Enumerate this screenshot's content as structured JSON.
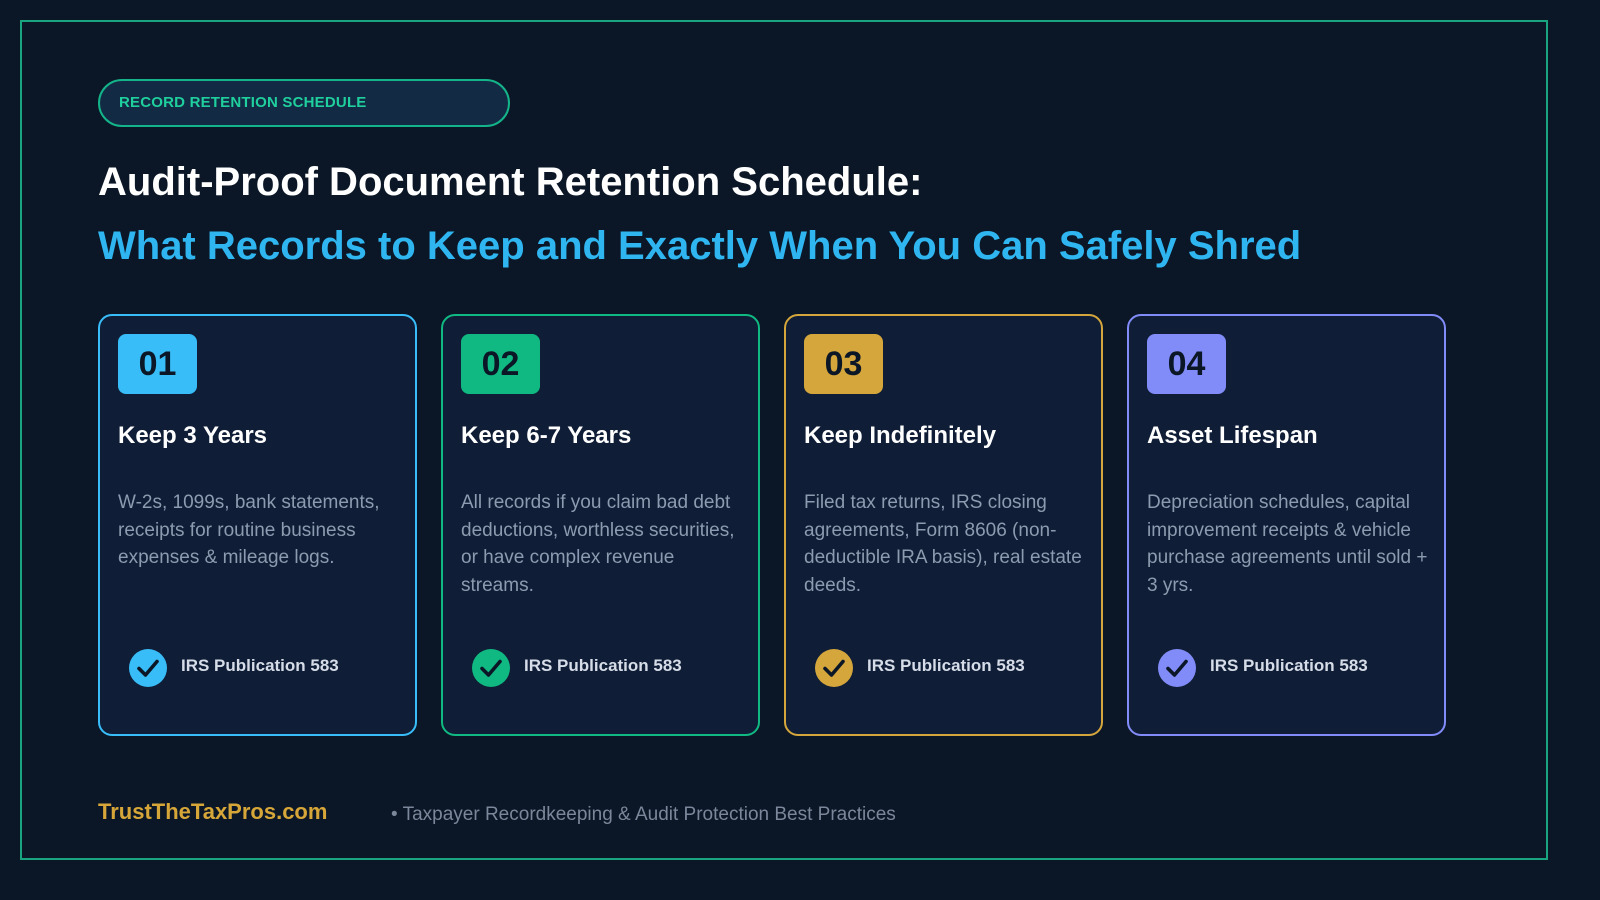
{
  "header": {
    "pill_label": "RECORD RETENTION SCHEDULE",
    "title_line1": "Audit-Proof Document Retention Schedule:",
    "title_line2": "What Records to Keep and Exactly When You Can Safely Shred"
  },
  "cards": [
    {
      "number": "01",
      "title": "Keep 3 Years",
      "description": "W-2s, 1099s, bank statements, receipts for routine business expenses & mileage logs.",
      "source": "IRS Publication 583",
      "color": "#38bdf8"
    },
    {
      "number": "02",
      "title": "Keep 6-7 Years",
      "description": "All records if you claim bad debt deductions, worthless securities, or have complex revenue streams.",
      "source": "IRS Publication 583",
      "color": "#10b981"
    },
    {
      "number": "03",
      "title": "Keep Indefinitely",
      "description": "Filed tax returns, IRS closing agreements, Form 8606 (non-deductible IRA basis), real estate deeds.",
      "source": "IRS Publication 583",
      "color": "#d4a63b"
    },
    {
      "number": "04",
      "title": "Asset Lifespan",
      "description": "Depreciation schedules, capital improvement receipts & vehicle purchase agreements until sold + 3 yrs.",
      "source": "IRS Publication 583",
      "color": "#818cf8"
    }
  ],
  "footer": {
    "brand": "TrustTheTaxPros.com",
    "tagline": "• Taxpayer Recordkeeping & Audit Protection Best Practices"
  },
  "icons": {
    "source_check": "checkmark-circle-icon"
  }
}
